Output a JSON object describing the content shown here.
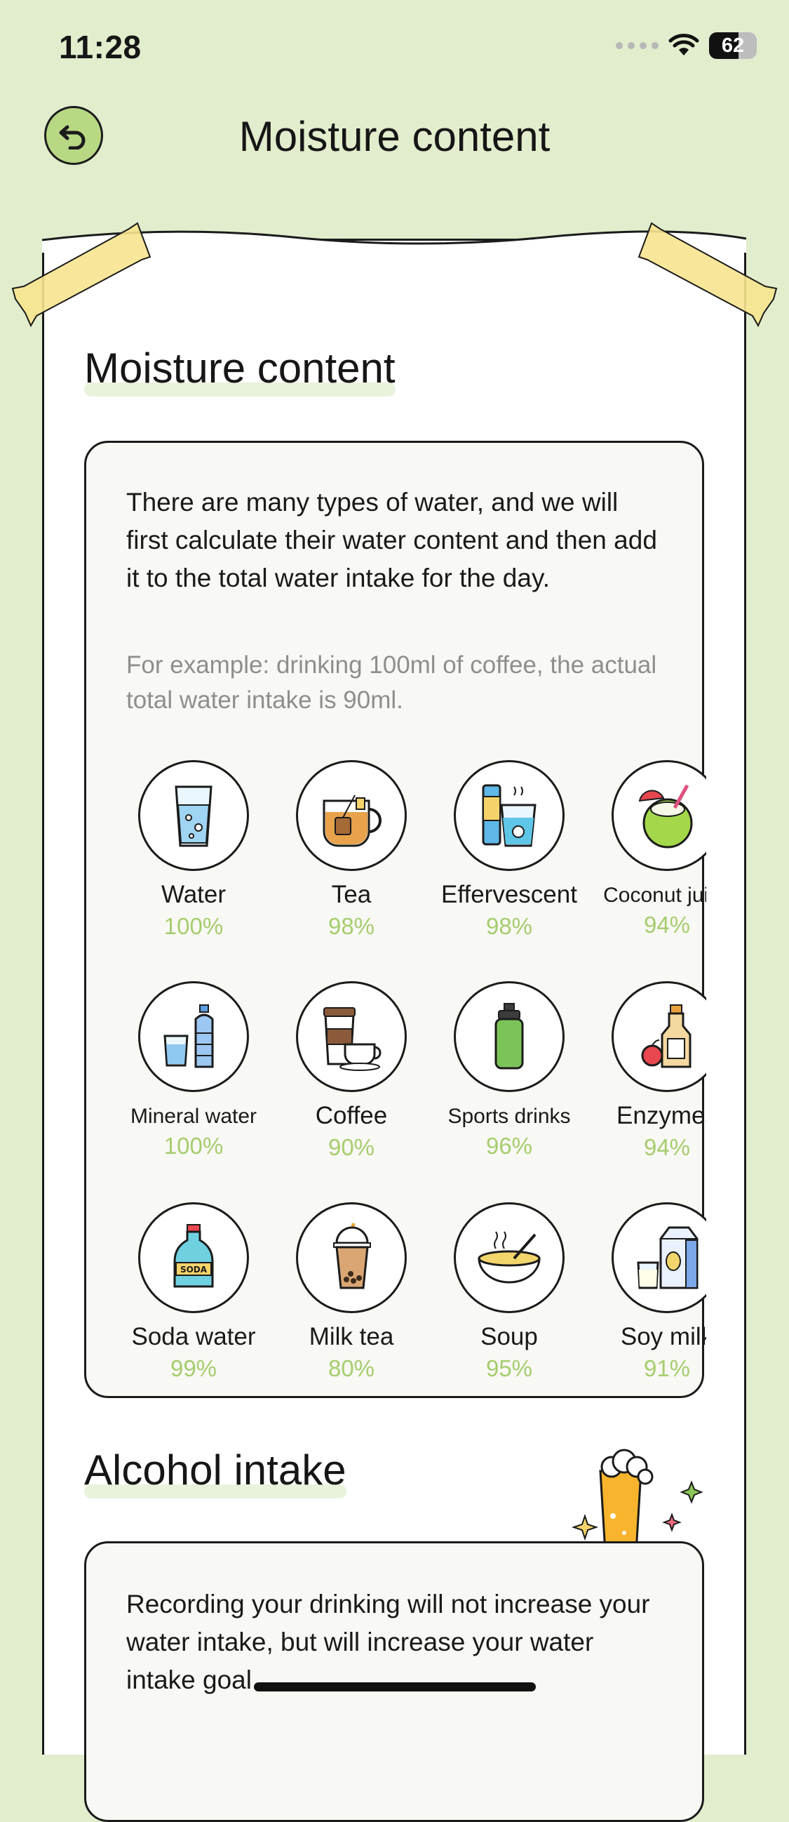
{
  "status_bar": {
    "time": "11:28",
    "battery": "62"
  },
  "header": {
    "title": "Moisture content"
  },
  "moisture_section": {
    "title": "Moisture content",
    "description": "There are many types of water, and we will first calculate their water content and then add it to the total water intake for the day.",
    "example": "For example: drinking 100ml of coffee, the actual total water intake is 90ml.",
    "drinks": [
      {
        "name": "Water",
        "percent": "100%",
        "icon": "water-glass-icon"
      },
      {
        "name": "Tea",
        "percent": "98%",
        "icon": "tea-cup-icon"
      },
      {
        "name": "Effervescent",
        "percent": "98%",
        "icon": "effervescent-icon"
      },
      {
        "name": "Coconut juice",
        "percent": "94%",
        "icon": "coconut-icon"
      },
      {
        "name": "Mineral water",
        "percent": "100%",
        "icon": "mineral-water-icon"
      },
      {
        "name": "Coffee",
        "percent": "90%",
        "icon": "coffee-icon"
      },
      {
        "name": "Sports drinks",
        "percent": "96%",
        "icon": "sports-bottle-icon"
      },
      {
        "name": "Enzymes",
        "percent": "94%",
        "icon": "enzyme-bottle-icon"
      },
      {
        "name": "Soda water",
        "percent": "99%",
        "icon": "soda-bottle-icon"
      },
      {
        "name": "Milk tea",
        "percent": "80%",
        "icon": "milk-tea-icon"
      },
      {
        "name": "Soup",
        "percent": "95%",
        "icon": "soup-bowl-icon"
      },
      {
        "name": "Soy milk",
        "percent": "91%",
        "icon": "soy-milk-icon"
      }
    ]
  },
  "alcohol_section": {
    "title": "Alcohol intake",
    "description": "Recording your drinking will not increase your water intake, but will increase your water intake goal."
  },
  "colors": {
    "background": "#e1edcc",
    "accent_green": "#a6cd6e",
    "tape": "#f5e18e"
  }
}
